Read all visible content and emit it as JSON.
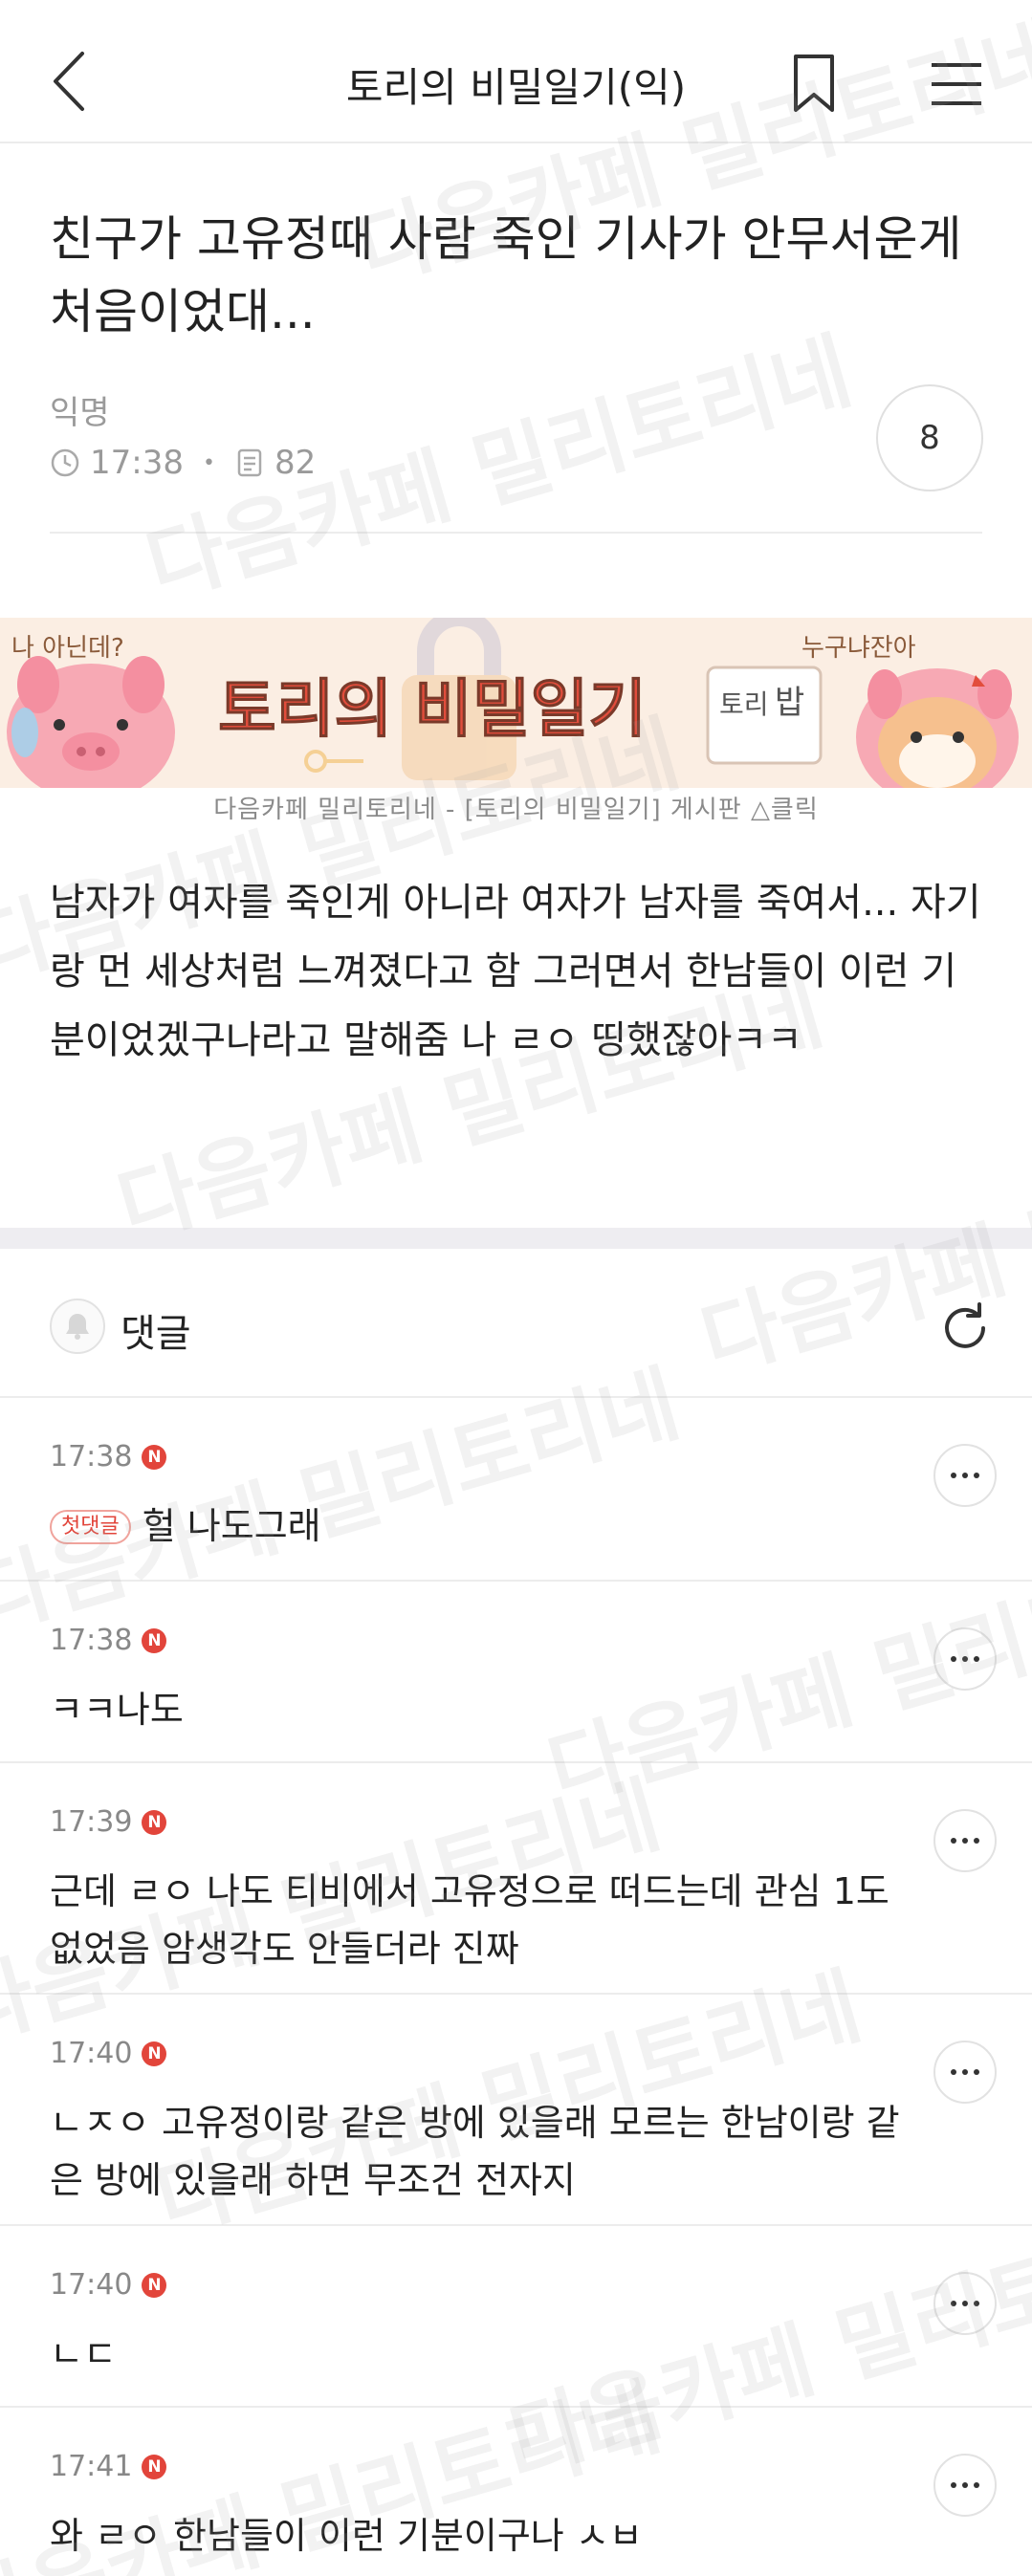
{
  "header": {
    "title": "토리의 비밀일기(익)"
  },
  "post": {
    "title": "친구가 고유정때 사람 죽인 기사가 안무서운게 처음이었대...",
    "author": "익명",
    "time": "17:38",
    "views": "82",
    "comment_count": "8",
    "body": "남자가 여자를 죽인게 아니라 여자가 남자를 죽여서... 자기랑 먼 세상처럼 느껴졌다고 함 그러면서 한남들이 이런 기분이었겠구나라고 말해줌 나 ㄹㅇ 띵했잖아ㅋㅋ"
  },
  "banner": {
    "title": "토리의 비밀일기",
    "stamp_top": "토리",
    "stamp_bottom": "밥",
    "left_bubble": "나 아닌데?",
    "right_bubble": "누구냐잔아",
    "caption": "다음카페 밀리토리네 - [토리의 비밀일기] 게시판 △클릭"
  },
  "comments_section": {
    "label": "댓글"
  },
  "comments": [
    {
      "time": "17:38",
      "badge": "N",
      "first_label": "첫댓글",
      "text": "헐 나도그래"
    },
    {
      "time": "17:38",
      "badge": "N",
      "text": "ㅋㅋ나도"
    },
    {
      "time": "17:39",
      "badge": "N",
      "text": "근데 ㄹㅇ 나도 티비에서 고유정으로 떠드는데 관심 1도 없었음 암생각도 안들더라 진짜"
    },
    {
      "time": "17:40",
      "badge": "N",
      "text": "ㄴㅈㅇ 고유정이랑 같은 방에 있을래 모르는 한남이랑 같은 방에 있을래 하면 무조건 전자지"
    },
    {
      "time": "17:40",
      "badge": "N",
      "text": "ㄴㄷ"
    },
    {
      "time": "17:41",
      "badge": "N",
      "text": "와 ㄹㅇ 한남들이 이런 기분이구나 ㅅㅂ"
    }
  ],
  "watermark": {
    "text": "다음카페 밀리토리네"
  },
  "colors": {
    "accent_red": "#e2453b",
    "banner_bg": "#fbeee3",
    "pig_pink": "#f7a9b4",
    "divider": "#ececec"
  },
  "icons": [
    "back-arrow-icon",
    "bookmark-icon",
    "hamburger-menu-icon",
    "clock-icon",
    "document-icon",
    "bell-icon",
    "refresh-icon",
    "more-options-icon"
  ]
}
